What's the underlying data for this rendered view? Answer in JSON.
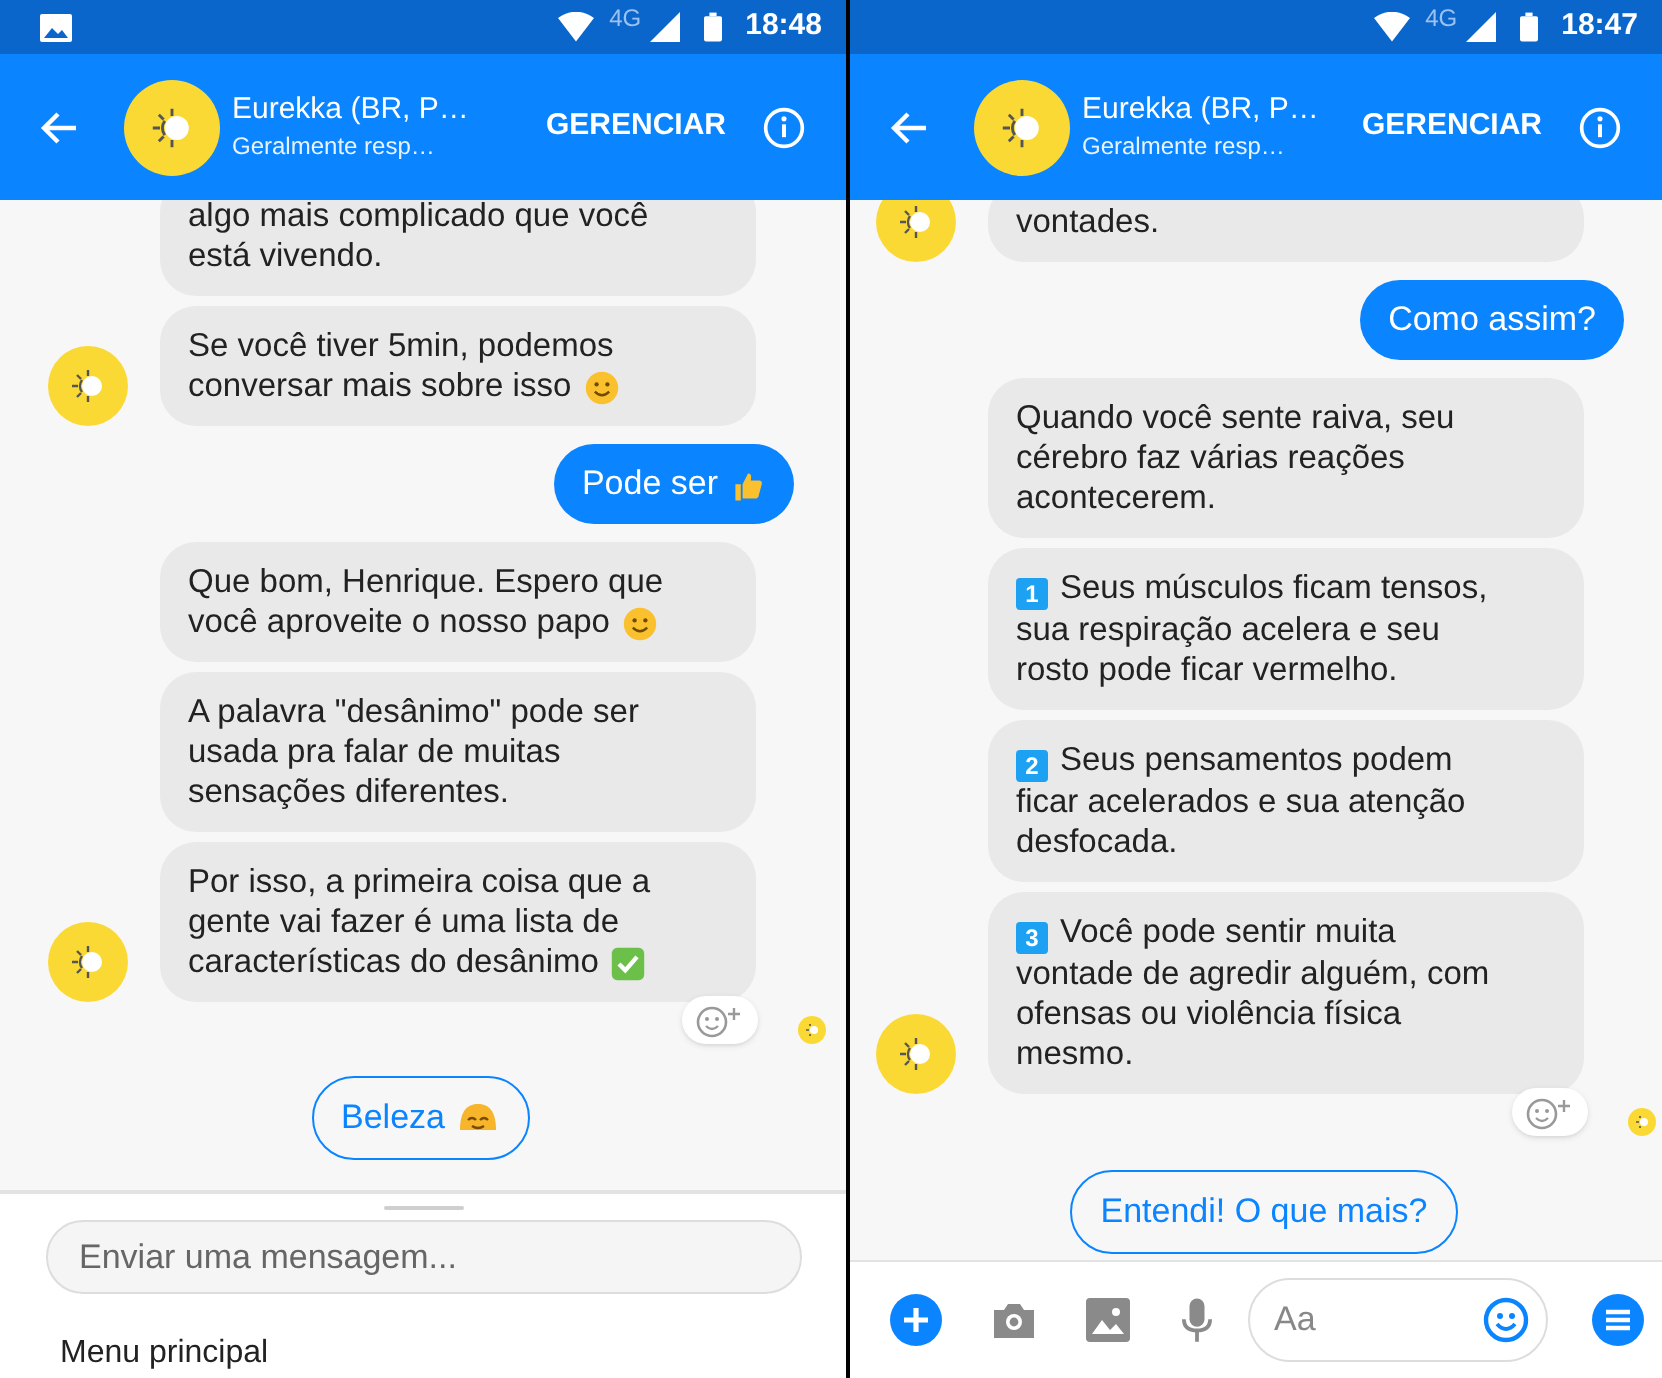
{
  "screens": [
    {
      "status_bar": {
        "notification_icon": true,
        "network": "4G",
        "time": "18:48"
      },
      "header": {
        "title": "Eurekka (BR, P…",
        "subtitle": "Geralmente resp…",
        "action": "GERENCIAR"
      },
      "messages": [
        {
          "kind": "received",
          "text": "algo mais complicado que você\nestá vivendo.",
          "cut_off": true,
          "avatar": false
        },
        {
          "kind": "received",
          "text": "Se você tiver 5min, podemos\nconversar mais sobre isso",
          "emoji": {
            "kind": "smile"
          },
          "cut_off": false,
          "avatar": true
        },
        {
          "kind": "sent",
          "text": "Pode ser",
          "emoji": {
            "kind": "thumbs"
          },
          "cut_off": false
        },
        {
          "kind": "received",
          "text": "Que bom, Henrique. Espero que\nvocê aproveite o nosso papo",
          "emoji": {
            "kind": "smile"
          },
          "cut_off": false,
          "avatar": false
        },
        {
          "kind": "received",
          "text": "A palavra \"desânimo\" pode ser\nusada pra falar de muitas\nsensações diferentes.",
          "cut_off": false,
          "avatar": false
        },
        {
          "kind": "received",
          "text": "Por isso, a primeira coisa que a\ngente vai fazer é uma lista de\ncaracterísticas do desânimo",
          "emoji": {
            "kind": "check"
          },
          "cut_off": false,
          "avatar": true
        }
      ],
      "reaction_button": true,
      "seen_avatar": true,
      "quick_reply": {
        "label": "Beleza",
        "emoji": {
          "kind": "blush"
        }
      },
      "composer": {
        "kind": "field",
        "placeholder": "Enviar uma mensagem...",
        "menu_label": "Menu principal"
      }
    },
    {
      "status_bar": {
        "notification_icon": false,
        "network": "4G",
        "time": "18:47"
      },
      "header": {
        "title": "Eurekka (BR, P…",
        "subtitle": "Geralmente resp…",
        "action": "GERENCIAR"
      },
      "messages": [
        {
          "kind": "received",
          "text": "vontades.",
          "cut_off": true,
          "avatar": true
        },
        {
          "kind": "sent",
          "text": "Como assim?",
          "cut_off": false
        },
        {
          "kind": "received",
          "text": "Quando você sente raiva, seu\ncérebro faz várias reações\nacontecerem.",
          "cut_off": false,
          "avatar": false
        },
        {
          "kind": "received",
          "badge": "1",
          "text": "Seus músculos ficam tensos,\nsua respiração acelera e seu\nrosto pode ficar vermelho.",
          "cut_off": false,
          "avatar": false
        },
        {
          "kind": "received",
          "badge": "2",
          "text": "Seus pensamentos podem\nficar acelerados e sua atenção\ndesfocada.",
          "cut_off": false,
          "avatar": false
        },
        {
          "kind": "received",
          "badge": "3",
          "text": "Você pode sentir muita\nvontade de agredir alguém, com\nofensas ou violência física\nmesmo.",
          "cut_off": false,
          "avatar": true
        }
      ],
      "reaction_button": true,
      "seen_avatar": true,
      "quick_reply": {
        "label": "Entendi! O que mais?"
      },
      "composer": {
        "kind": "toolbar",
        "placeholder": "Aa"
      }
    }
  ]
}
